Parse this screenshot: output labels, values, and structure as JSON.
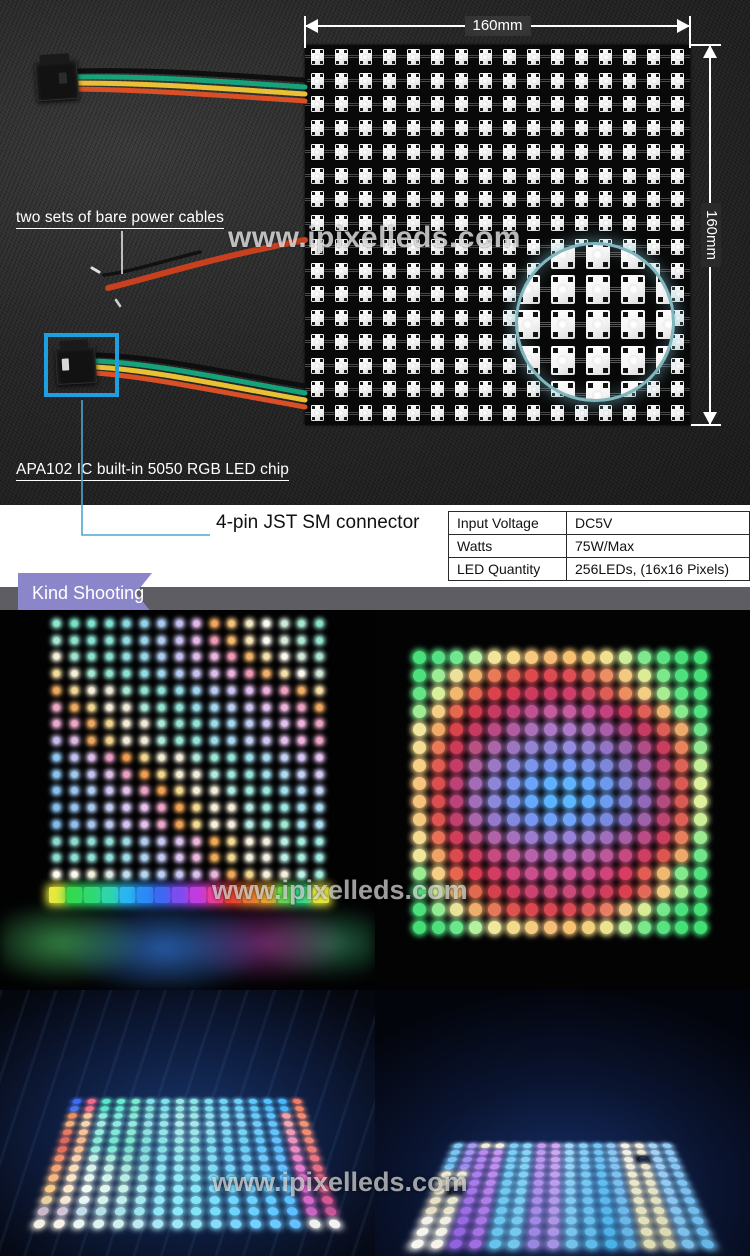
{
  "hero": {
    "dimension_top": "160mm",
    "dimension_right": "160mm",
    "watermark": "www.ipixelleds.com",
    "annotations": {
      "power_cables": "two sets of bare power cables",
      "led_chip": "APA102 IC built-in 5050 RGB LED chip",
      "connector": "4-pin JST SM connector"
    }
  },
  "spec_table": {
    "rows": [
      {
        "key": "Input Voltage",
        "value": "DC5V"
      },
      {
        "key": "Watts",
        "value": "75W/Max"
      },
      {
        "key": "LED Quantity",
        "value": "256LEDs, (16x16 Pixels)"
      }
    ]
  },
  "ribbon": {
    "label": "Kind Shooting"
  },
  "gallery": {
    "watermark_row1": "www.ipixelleds.com",
    "watermark_row2": "www.ipixelleds.com"
  },
  "panel": {
    "columns": 16,
    "rows": 16,
    "total_leds": 256
  },
  "colors": {
    "highlight_box": "#1f9fe0",
    "leader_line": "#4aa8cf",
    "magnifier_ring": "#96d7e1",
    "ribbon": "#8b86c9",
    "ribbon_fold": "#615c94",
    "gray_bar": "#5d5d63",
    "pcb": "#090909",
    "led_body": "#ffffff"
  },
  "photo_a_palette": [
    "#8fe6d0",
    "#79e2c9",
    "#7fe3d2",
    "#84e0d4",
    "#8ad8e2",
    "#93d2ea",
    "#a9c9ef",
    "#c3bff0",
    "#e3b6e8",
    "#f0a65c",
    "#f6c27a",
    "#f2e9c2",
    "#fdfbf0",
    "#cfe9d8",
    "#a4e5cf",
    "#8ae2cb",
    "#a7e8d6",
    "#8fe4cf",
    "#86e2d1",
    "#8ce1d6",
    "#94dae4",
    "#9ed4ec",
    "#b2cbf0",
    "#cabff0",
    "#e6b9ea",
    "#f09ab4",
    "#f5b96e",
    "#f7e3b4",
    "#fdfbf2",
    "#d8ebdd",
    "#aee7d4",
    "#95e4cf",
    "#f4efd8",
    "#9ee6d1",
    "#8ce3ce",
    "#8ae1d3",
    "#90dfe0",
    "#99d6ec",
    "#aeccf1",
    "#c6c0f1",
    "#e0bbec",
    "#eeb4e0",
    "#f09ab6",
    "#f4b36a",
    "#f7e0ab",
    "#fcf9ef",
    "#d4ead9",
    "#a9e6d2",
    "#f3d99a",
    "#f6efd9",
    "#a5e7d4",
    "#92e4d0",
    "#8ce2d6",
    "#93dce6",
    "#9fd5ef",
    "#b6ccf2",
    "#c9c2f2",
    "#ddbdec",
    "#edb1dd",
    "#f09bb8",
    "#f3b06a",
    "#f6dfa8",
    "#fbf8ee",
    "#cfe8d7",
    "#efa95f",
    "#f4d795",
    "#f7efdb",
    "#ece7d4",
    "#a7e7d6",
    "#93e4d1",
    "#8de2d7",
    "#95dce8",
    "#a2d6f0",
    "#b9cdf2",
    "#ccc3f2",
    "#dfbeed",
    "#eeb0dc",
    "#f0a3c0",
    "#f2ae67",
    "#f5dda5",
    "#eda7c4",
    "#eeab62",
    "#f3d692",
    "#f6eed9",
    "#efe9d6",
    "#a9e8d8",
    "#95e5d3",
    "#8fe3d8",
    "#97dde9",
    "#a4d7f1",
    "#bbcef3",
    "#cec4f3",
    "#e1bfee",
    "#eeb1dd",
    "#eda2c2",
    "#f0a95f",
    "#e8a8d0",
    "#eda6c6",
    "#eda963",
    "#f2d590",
    "#f5edd8",
    "#f0ead7",
    "#abe9da",
    "#97e6d5",
    "#91e4da",
    "#99deeb",
    "#a6d8f2",
    "#bdcff4",
    "#d0c5f4",
    "#e3c0ef",
    "#eeb2de",
    "#eda3c4",
    "#c6baee",
    "#dfb9e4",
    "#eca660",
    "#f1d38e",
    "#f4ecd6",
    "#f1ebd8",
    "#ade9dc",
    "#99e7d7",
    "#93e5dc",
    "#9bdfec",
    "#a8d9f3",
    "#bfd0f5",
    "#d2c6f5",
    "#e5c1f0",
    "#efb3df",
    "#eea4c6",
    "#8fc8f0",
    "#c0c0f2",
    "#ddbee9",
    "#e89fc2",
    "#ef9e52",
    "#f2d68c",
    "#f5eed5",
    "#f2ecd9",
    "#afeade",
    "#9be8d9",
    "#95e6de",
    "#9de0ed",
    "#aadaf4",
    "#c1d1f6",
    "#d4c7f6",
    "#e7c2f1",
    "#8bc5ef",
    "#9fc9f1",
    "#c4c2f3",
    "#e0c0ea",
    "#eaa1c4",
    "#f09f53",
    "#f3d78d",
    "#f6efd6",
    "#f3edda",
    "#b1ebe0",
    "#9de9db",
    "#97e7e0",
    "#9fe1ee",
    "#acdbf5",
    "#c3d2f7",
    "#d6c8f7",
    "#87c2ee",
    "#9ac6f0",
    "#b0cdf2",
    "#cfc4f4",
    "#e4c1ec",
    "#eca3c6",
    "#f1a054",
    "#f4d88e",
    "#f7f0d7",
    "#f4eedb",
    "#b3ece2",
    "#9feadc",
    "#99e8e1",
    "#a1e2ef",
    "#aedcf6",
    "#c5d3f8",
    "#83bfed",
    "#96c3ef",
    "#abcaf1",
    "#c2cdf3",
    "#d8c6f5",
    "#e9c3ee",
    "#eda5c8",
    "#f2a155",
    "#f5d98f",
    "#f8f1d8",
    "#f5efdc",
    "#b5ede4",
    "#a1ebde",
    "#9be9e2",
    "#a3e3f0",
    "#b0ddf7",
    "#7fbcec",
    "#92c0ee",
    "#a7c7f0",
    "#becaf2",
    "#d4c3f4",
    "#e5c0ec",
    "#eca7ca",
    "#f3a256",
    "#f6da90",
    "#f9f2d9",
    "#f6f0dd",
    "#b7eee6",
    "#a3ecdf",
    "#9dead0",
    "#a5e4f1",
    "#b2def8",
    "#8ed9cf",
    "#8fdcd2",
    "#92ddd6",
    "#96dedb",
    "#9fd9e6",
    "#b0cff0",
    "#c6c6f4",
    "#ddc1ee",
    "#eeb6d8",
    "#f1a857",
    "#f4d991",
    "#f7f1da",
    "#f5efde",
    "#b9efe7",
    "#a5ede0",
    "#9febe3",
    "#8ddbd1",
    "#8edfd5",
    "#91e0d9",
    "#95e1de",
    "#9edce9",
    "#afd2f3",
    "#c5c9f7",
    "#dcc4f1",
    "#edb9db",
    "#f0ab5a",
    "#f3da94",
    "#f6f2dd",
    "#f4f0e1",
    "#bbf0e9",
    "#a7eee2",
    "#a1ece5",
    "#fdfbf2",
    "#fdfaf0",
    "#f6f0de",
    "#dfe9e6",
    "#c2dff0",
    "#b6d7f4",
    "#bdd2f6",
    "#cbc9f5",
    "#dcc2ef",
    "#ecb7da",
    "#f0aa5c",
    "#f3d992",
    "#f6f1db",
    "#f5f0e0",
    "#bdf1ea",
    "#a3ede1"
  ],
  "photo_b_palette": [
    "#48e07a",
    "#55e084",
    "#6fe68f",
    "#b9f0a0",
    "#f2e49a",
    "#f6d98a",
    "#f7c97e",
    "#f6bb76",
    "#f7c070",
    "#f3cf7c",
    "#f1e08d",
    "#cdee9a",
    "#7fe88e",
    "#5ce283",
    "#4adf79",
    "#45de76",
    "#4fe07e",
    "#9ceb95",
    "#eae19a",
    "#f0b06a",
    "#e87a58",
    "#e05a50",
    "#dc4a4e",
    "#dd4a52",
    "#dd4f55",
    "#e2685a",
    "#eb8e63",
    "#f3c982",
    "#dcec96",
    "#7ce88c",
    "#4fe07d",
    "#48df78",
    "#64e486",
    "#d8ef9b",
    "#f0b96f",
    "#e4664f",
    "#d9434b",
    "#d13a52",
    "#cc3a5e",
    "#cb3c66",
    "#cd3f68",
    "#d24a62",
    "#dd5d58",
    "#ec8d62",
    "#f4cd85",
    "#aaec92",
    "#5ee384",
    "#4fe07c",
    "#9deb93",
    "#f3cf85",
    "#e4684f",
    "#d23b4f",
    "#c63a62",
    "#c04478",
    "#bf5191",
    "#c35b9c",
    "#c45ea0",
    "#c35196",
    "#c2427f",
    "#cc3b62",
    "#de5f57",
    "#f0b371",
    "#88e98d",
    "#54e180",
    "#f0e69d",
    "#efab68",
    "#d9444c",
    "#c43a61",
    "#b94a82",
    "#b05da0",
    "#ab6fb8",
    "#ad78c4",
    "#ae7bc8",
    "#ac72be",
    "#a95fa8",
    "#b04a88",
    "#c43c63",
    "#dd5e56",
    "#ecab6c",
    "#6ee589",
    "#f4dd92",
    "#e97a59",
    "#cd3b57",
    "#b9507f",
    "#aa66a6",
    "#9d76c0",
    "#9584d2",
    "#9389db",
    "#948cdf",
    "#9385d5",
    "#9375c4",
    "#9b64aa",
    "#b14d86",
    "#c93e5e",
    "#e8835d",
    "#93ea90",
    "#f6cf85",
    "#e05d52",
    "#c43c65",
    "#ae61a0",
    "#9b78c3",
    "#8a88dc",
    "#7c94ea",
    "#7899f2",
    "#799cf4",
    "#7a95ea",
    "#7d87da",
    "#8a74c2",
    "#a05da3",
    "#bd4270",
    "#dd6357",
    "#c5ee98",
    "#f6c47e",
    "#db4f4f",
    "#bd4275",
    "#a46cb4",
    "#8e85d6",
    "#7b95ec",
    "#6aa4fa",
    "#5fb0ff",
    "#61b2ff",
    "#64a9fb",
    "#6e98ec",
    "#7e84d6",
    "#9368b4",
    "#b44b7c",
    "#d85a54",
    "#ddf09c",
    "#f6c37d",
    "#da4e4f",
    "#bb4377",
    "#a26eb8",
    "#8b88da",
    "#7898ef",
    "#66a8fd",
    "#5ab4ff",
    "#5db6ff",
    "#61adfe",
    "#6c9bef",
    "#7c87da",
    "#9169b7",
    "#b34c7e",
    "#d75a54",
    "#e0f19d",
    "#f5c881",
    "#dd5551",
    "#c13f6c",
    "#aa66ab",
    "#9479ca",
    "#8389de",
    "#7697ef",
    "#6ea2f8",
    "#70a4f9",
    "#7399f0",
    "#7a8ade",
    "#8775c9",
    "#9e62a9",
    "#bc4574",
    "#dc6056",
    "#cfee99",
    "#f3da8f",
    "#e87057",
    "#cf3d5a",
    "#bb4f84",
    "#b063a6",
    "#a571bd",
    "#9b7ccd",
    "#9681d6",
    "#9783d8",
    "#9a7ccd",
    "#9f6fbb",
    "#a75fa5",
    "#b94c84",
    "#cc3f60",
    "#e77f5c",
    "#9deb91",
    "#efe69c",
    "#eda366",
    "#db4a4d",
    "#cf3d63",
    "#c64b7f",
    "#bd5999",
    "#b663ab",
    "#b368b4",
    "#b36ab6",
    "#b564ac",
    "#bb589a",
    "#c34b80",
    "#ce3d63",
    "#dd5451",
    "#eca96a",
    "#72e68a",
    "#9aeb92",
    "#f3ce84",
    "#e6664f",
    "#d93c50",
    "#d23d63",
    "#cc457b",
    "#c94f8d",
    "#c85494",
    "#c95597",
    "#cb4e8c",
    "#cf447a",
    "#d73d62",
    "#e25d53",
    "#f0b873",
    "#85e98b",
    "#52e17f",
    "#5fe485",
    "#d6ef9a",
    "#efbb70",
    "#e06a50",
    "#d4414c",
    "#cd3d5c",
    "#c9436e",
    "#c84877",
    "#c94a7a",
    "#cb446f",
    "#d03e5d",
    "#d8404f",
    "#e2695a",
    "#f2cb84",
    "#a7ec91",
    "#5be383",
    "#4ce07c",
    "#93ea92",
    "#e8e29b",
    "#eeae6b",
    "#e4785a",
    "#dd5150",
    "#d9464f",
    "#d94653",
    "#da4a56",
    "#de5d5b",
    "#e67c64",
    "#f1c384",
    "#d9eb95",
    "#79e78b",
    "#4ce07c",
    "#47df78",
    "#45de76",
    "#4fe07d",
    "#6ae68c",
    "#b4f09e",
    "#f0e69c",
    "#f4db8c",
    "#f5cb80",
    "#f5bd78",
    "#f6c272",
    "#f2d17e",
    "#efe28f",
    "#c8ee9c",
    "#7ae78c",
    "#58e281",
    "#47df77",
    "#43de74"
  ],
  "photo_c_palette": [
    "#3d6cf0",
    "#f06a8a",
    "#5ae6c8",
    "#6ae8d2",
    "#7ce9cf",
    "#7fe0e8",
    "#7ee2ea",
    "#96e8e6",
    "#8de4e4",
    "#7ddcf0",
    "#72d4f4",
    "#6fd0f6",
    "#5fc8f8",
    "#56c0fa",
    "#4ab8fb",
    "#f07a66",
    "#4a74ef",
    "#f2768f",
    "#58e4c6",
    "#67e6d0",
    "#7ae7cd",
    "#7dded6",
    "#7ce0e8",
    "#94e6e4",
    "#8be2e2",
    "#7bdaee",
    "#70d2f2",
    "#6dcef4",
    "#5dc6f6",
    "#54bef8",
    "#48b6f9",
    "#f28468",
    "#e98f64",
    "#f7c79a",
    "#8feadd",
    "#7de8d8",
    "#86e8d4",
    "#88dfe0",
    "#8fe3e6",
    "#a6eae8",
    "#9ce6e6",
    "#8ddeee",
    "#7fd6f2",
    "#78d2f4",
    "#6acaf6",
    "#5fc2f8",
    "#f1a0a8",
    "#f38c70",
    "#f2b07a",
    "#f9d6b0",
    "#a2ece4",
    "#8deae0",
    "#93e9dc",
    "#94e0e4",
    "#9ae5ea",
    "#b0ecec",
    "#a7e8ea",
    "#97e0f0",
    "#89d8f4",
    "#80d4f6",
    "#71ccf8",
    "#66c4fa",
    "#f2a8b0",
    "#f29478",
    "#e67a64",
    "#f6c398",
    "#9bebe0",
    "#84e8da",
    "#8ce8d6",
    "#8ee0e0",
    "#94e4e8",
    "#a8eaea",
    "#9fe6e8",
    "#8fdeee",
    "#81d6f2",
    "#78d2f4",
    "#6ecaf8",
    "#68c2fa",
    "#ef9cb8",
    "#ef8c74",
    "#d96a5e",
    "#f2b78c",
    "#8ae8d8",
    "#76e6d0",
    "#7ee6cc",
    "#82ded8",
    "#88e2e4",
    "#9ce8e6",
    "#93e4e4",
    "#84dcec",
    "#76d4f0",
    "#6ed0f4",
    "#66c8f8",
    "#62c0fa",
    "#ec94c0",
    "#ec8478",
    "#e0705e",
    "#f4bd92",
    "#93eadc",
    "#7fe8d4",
    "#7cdfd0",
    "#80d8dc",
    "#86dee8",
    "#98e6ea",
    "#8fe2e8",
    "#80daf0",
    "#72d2f4",
    "#6ccef6",
    "#64c6f8",
    "#5ebefa",
    "#ea8cc4",
    "#ea7c7c",
    "#ef8e6a",
    "#f8cfa8",
    "#c0f0e4",
    "#a8ecdc",
    "#96e4d6",
    "#8ce0e0",
    "#8ae2ec",
    "#96e6ee",
    "#8ee2ec",
    "#82daf2",
    "#78d2f6",
    "#74cef8",
    "#6cc6fa",
    "#66befc",
    "#e884c8",
    "#e87480",
    "#f3a274",
    "#fadcb8",
    "#d8f4ec",
    "#c0f0e4",
    "#a8e8dc",
    "#94e2e4",
    "#8ce4f0",
    "#94e8f2",
    "#8ce4f0",
    "#80dcf4",
    "#76d4f8",
    "#72d0fa",
    "#6ac8fc",
    "#64c0fe",
    "#e67ccc",
    "#e66c84",
    "#f6b67e",
    "#fce4c4",
    "#e4f8f0",
    "#d0f4ea",
    "#b8ece2",
    "#a0e6e8",
    "#90e6f4",
    "#92eaf6",
    "#8ae6f4",
    "#7edef8",
    "#74d6fa",
    "#70d2fc",
    "#68cafe",
    "#62c2ff",
    "#e474d0",
    "#e46488",
    "#f8c888",
    "#fde8cc",
    "#f0fcf6",
    "#e0f8f0",
    "#c8f2e8",
    "#acecee",
    "#96e8f8",
    "#90ecfa",
    "#88e8f8",
    "#7ce0fc",
    "#72d8fe",
    "#6ed4ff",
    "#66ccff",
    "#60c4ff",
    "#e26cd4",
    "#e25c8c",
    "#ead0a0",
    "#f5e8d4",
    "#e8f8f4",
    "#d4f4ee",
    "#bef0ea",
    "#a6eaf0",
    "#92e8f8",
    "#8ceafa",
    "#84e6f8",
    "#7adefc",
    "#70d6fe",
    "#6cd2ff",
    "#64caff",
    "#5ec2ff",
    "#d868cc",
    "#d85894",
    "#c8b8c8",
    "#d2c4d4",
    "#c2dce8",
    "#b4e0e6",
    "#a8e2e8",
    "#9ce4ee",
    "#90e6f6",
    "#8ae8f8",
    "#82e4f6",
    "#78dcfa",
    "#6ed4fc",
    "#6ad0fe",
    "#62c8ff",
    "#5cc0ff",
    "#c864c0",
    "#c85498",
    "#f4f0e4",
    "#f6f2e8",
    "#eaf6f4",
    "#dcf4f0",
    "#cef0ee",
    "#bceaf0",
    "#a8e6f6",
    "#9ce8f8",
    "#92e4f6",
    "#86dcfa",
    "#7ad4fc",
    "#74d0fe",
    "#6cc8ff",
    "#66c0ff",
    "#f0f0f0",
    "#f2f2f2"
  ],
  "photo_d_palette": [
    "#7ec8f4",
    "#a89af0",
    "#f2f0d8",
    "#f4f2e0",
    "#7ecef6",
    "#8ad4f8",
    "#c49cf0",
    "#d2a8f2",
    "#a0d8f8",
    "#8ad0f6",
    "#76c6f4",
    "#8ec8f2",
    "#f4f2e4",
    "#f0eed8",
    "#a6d4f6",
    "#92ccf4",
    "#7ac6f3",
    "#a494ef",
    "#b88af0",
    "#c896f2",
    "#7ccdf6",
    "#88d3f8",
    "#c09af0",
    "#cea6f2",
    "#9cd6f8",
    "#86cef6",
    "#72c4f4",
    "#8ac6f2",
    "#f2f0e2",
    "#eeecd6",
    "#a2d2f6",
    "#8ecaf4",
    "#76c4f2",
    "#a090ee",
    "#b486ef",
    "#c492f1",
    "#7accf5",
    "#86d2f7",
    "#bc98ef",
    "#caa4f1",
    "#98d4f7",
    "#82ccf5",
    "#6ec2f3",
    "#86c4f1",
    "#f0eee0",
    "#eceacd4",
    "#9ed0f5",
    "#8ac8f3",
    "#72c2f1",
    "#9c8ced",
    "#b082ee",
    "#c08ef0",
    "#78cbf4",
    "#84d1f6",
    "#b896ee",
    "#c6a2f0",
    "#94d2f6",
    "#7ecaf4",
    "#6ac0f2",
    "#82c2f0",
    "#eeecde",
    "#eae8d2",
    "#9aceF4",
    "#86c6f2",
    "#eeecd8",
    "#f0eedc",
    "#ac7eec",
    "#bc8aee",
    "#76caf3",
    "#82d0f5",
    "#b494ed",
    "#c2a0ef",
    "#90d0f5",
    "#7ac8f3",
    "#66bef1",
    "#7ec0ef",
    "#ecead0",
    "#e8e6cc",
    "#96ccf3",
    "#82c4f1",
    "#ece8cc",
    "#eeecd8",
    "#a87aea",
    "#b886ec",
    "#74c9f2",
    "#80cff4",
    "#b092ec",
    "#be9eee",
    "#8ccef4",
    "#76c6f2",
    "#62bcf0",
    "#7abeee",
    "#eae8ca",
    "#e6e4c8",
    "#92caf2",
    "#7ec2f0",
    "#eae4c8",
    "#eceacd4",
    "#a476e8",
    "#b482ea",
    "#72c8f1",
    "#7ecef3",
    "#ac90ea",
    "#ba9cec",
    "#88ccf3",
    "#72c4f1",
    "#5ebaef",
    "#76bced",
    "#e8e6c6",
    "#e4e2c4",
    "#8ec8f1",
    "#7ac0ef",
    "#e8e0c4",
    "#eae8d0",
    "#a072e6",
    "#b07ee8",
    "#70c7f0",
    "#7ccdf2",
    "#a88ee8",
    "#b69aea",
    "#84caf2",
    "#6ec2f0",
    "#5ab8ee",
    "#72baeb",
    "#e6e4c2",
    "#e2e0c0",
    "#8ac6f0",
    "#76beed",
    "#e6dcc0",
    "#e8e6cc",
    "#9c6ee4",
    "#ac7ae6",
    "#6ec6ef",
    "#7acbf0",
    "#a48ce6",
    "#b298e8",
    "#80c8f0",
    "#6ac0ee",
    "#56b6ec",
    "#6eb8e9",
    "#e4e2be",
    "#e0debc",
    "#86c4ee",
    "#72bceb",
    "#f4f2e8",
    "#f2f0e2",
    "#986ae2",
    "#a876e4",
    "#6cc5ee",
    "#78c9ef",
    "#a08ae4",
    "#ae96e6",
    "#7cc6ee",
    "#66beec",
    "#52b4ea",
    "#6ab6e7",
    "#e2e0ba",
    "#deddb8",
    "#82c2ec",
    "#6ebae9",
    "#f6f4ec",
    "#f4f2e6",
    "#9466e0",
    "#a472e2",
    "#6ac4ec",
    "#76c7ee",
    "#9c88e2",
    "#aa94e4",
    "#78c4ec",
    "#62bcea",
    "#4eb2e8",
    "#66b4e5",
    "#e0deb6",
    "#dcdab4",
    "#7ec0ea",
    "#6ab8e7",
    "#f8f6f0",
    "#f6f4ea",
    "#9062de",
    "#a06ee0",
    "#68c3eb",
    "#74c5ec",
    "#9886e0",
    "#a692e2",
    "#74c2ea",
    "#5ebae8",
    "#4ab0e6",
    "#62b2e3",
    "#dedcb2",
    "#dad8b0",
    "#7abee8",
    "#66b6e5"
  ]
}
